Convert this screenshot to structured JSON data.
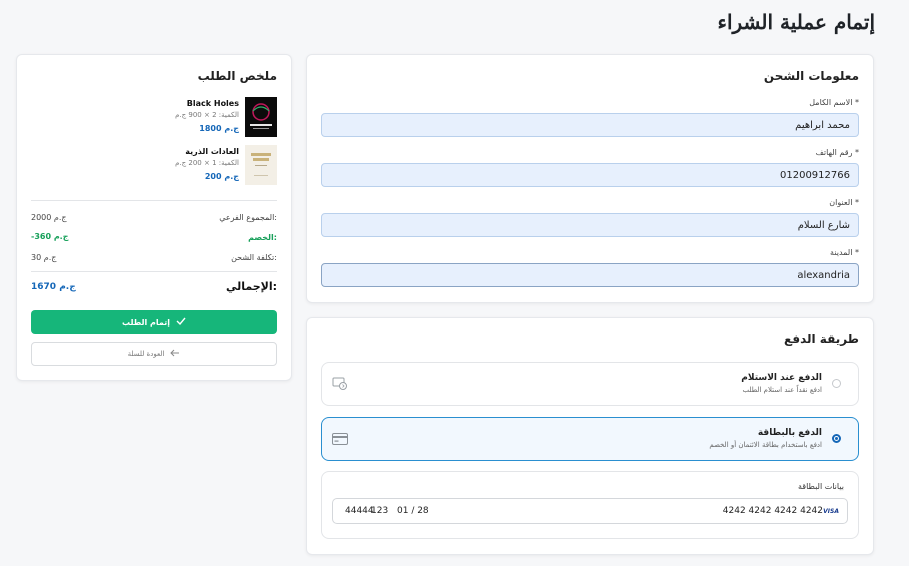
{
  "page_title": "إتمام عملية الشراء",
  "shipping": {
    "title": "معلومات الشحن",
    "fields": [
      {
        "label": "الاسم الكامل *",
        "value": "محمد ابراهيم"
      },
      {
        "label": "رقم الهاتف *",
        "value": "01200912766"
      },
      {
        "label": "العنوان *",
        "value": "شارع السلام"
      },
      {
        "label": "المدينة *",
        "value": "alexandria"
      }
    ]
  },
  "payment": {
    "title": "طريقة الدفع",
    "options": [
      {
        "title": "الدفع عند الاستلام",
        "description": "ادفع نقداً عند استلام الطلب",
        "icon": "cash-icon",
        "selected": false
      },
      {
        "title": "الدفع بالبطاقة",
        "description": "ادفع باستخدام بطاقة الائتمان أو الخصم",
        "icon": "credit-card-icon",
        "selected": true
      }
    ],
    "card_details": {
      "label": "بيانات البطاقة",
      "brand": "VISA",
      "number": "4242 4242 4242 4242",
      "expiry": "01 / 28",
      "cvc": "123",
      "zip": "44444"
    }
  },
  "summary": {
    "title": "ملخص الطلب",
    "items": [
      {
        "name": "Black Holes",
        "qty": "الكمية: 2 × 900 ج.م",
        "price": "1800 ج.م"
      },
      {
        "name": "العادات الذرية",
        "qty": "الكمية: 1 × 200 ج.م",
        "price": "200 ج.م"
      }
    ],
    "subtotal_label": "المجموع الفرعي:",
    "subtotal_value": "2000 ج.م",
    "discount_label": "الخصم:",
    "discount_value": "-360 ج.م",
    "shipping_label": "تكلفة الشحن:",
    "shipping_value": "30 ج.م",
    "total_label": "الإجمالي:",
    "total_value": "1670 ج.م",
    "complete_button": "إتمام الطلب",
    "back_button": "العودة للسلة"
  },
  "colors": {
    "primary": "#16b67a",
    "accent": "#1567b8",
    "input_bg": "#e7f0fd"
  }
}
